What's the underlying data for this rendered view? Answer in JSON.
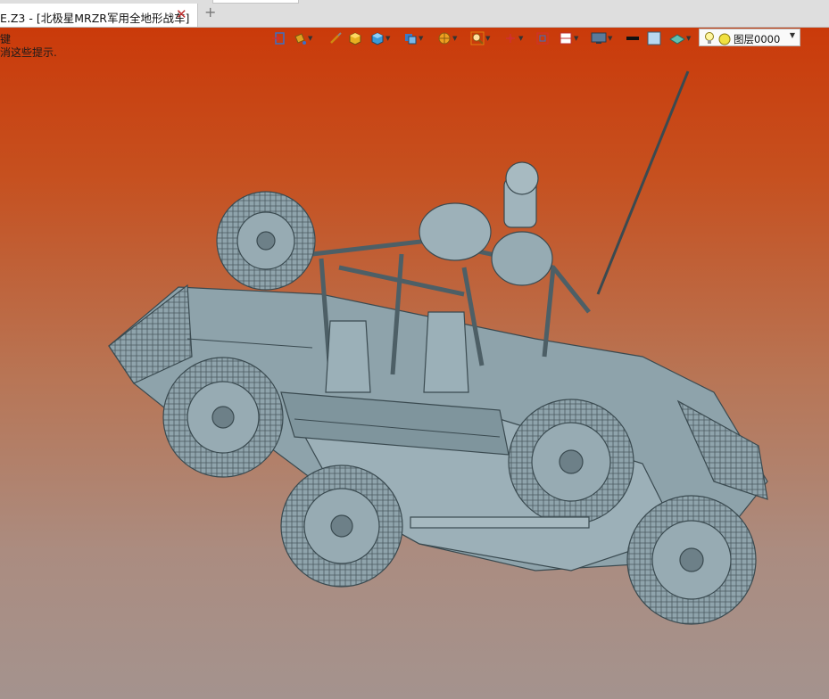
{
  "tab": {
    "title": "E.Z3 - [北极星MRZR军用全地形战车]",
    "close": "✕",
    "add": "+"
  },
  "hints": [
    "键",
    "消这些提示."
  ],
  "toolbar": {
    "icons": [
      "exit-icon",
      "bucket-icon",
      "brush-icon",
      "solid-box-icon",
      "cube-icon",
      "view-cube-icon",
      "render-style-icon",
      "zoom-icon",
      "triad-icon",
      "fit-view-icon",
      "layout-icon",
      "display-icon",
      "line-color-swatch-icon",
      "fill-color-swatch-icon",
      "layer-plane-icon"
    ],
    "layer": {
      "value": "图层0000"
    }
  },
  "colors": {
    "bg_top": "#ca3a0a",
    "bg_bottom": "#a4938e",
    "model": "#8aa0a8",
    "model_line": "#3a4a50"
  },
  "scene": {
    "object": "北极星MRZR军用全地形战车"
  }
}
